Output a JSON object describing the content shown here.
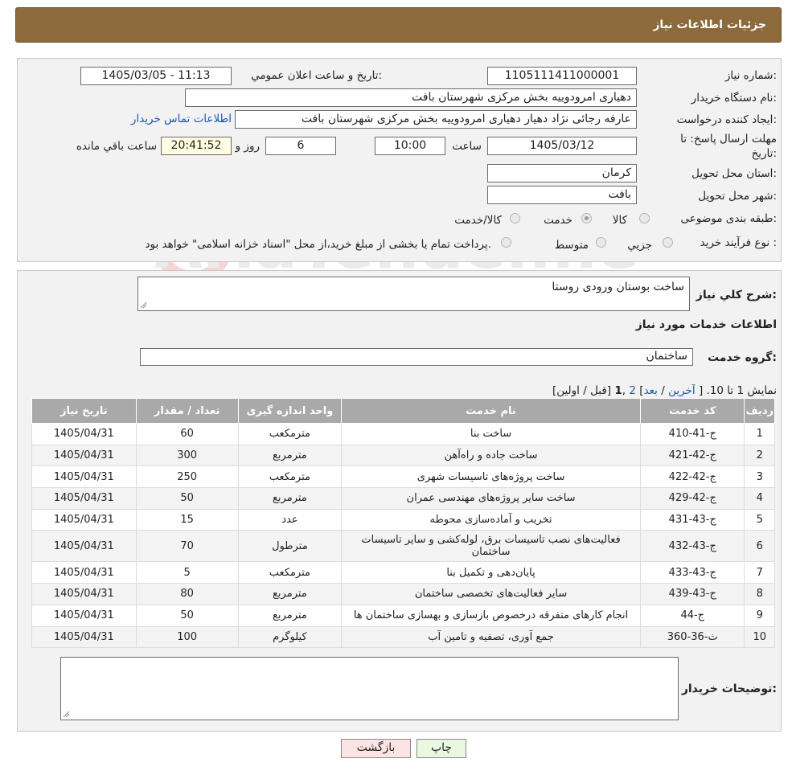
{
  "header": {
    "title": "جزئیات اطلاعات نیاز"
  },
  "form": {
    "need_number_label": "شماره نیاز:",
    "need_number": "1105111411000001",
    "announce_label": "تاریخ و ساعت اعلان عمومي:",
    "announce_value": "1405/03/05 - 11:13",
    "buyer_org_label": "نام دستگاه خريدار:",
    "buyer_org": "دهیاری امرودوییه بخش مرکزی شهرستان بافت",
    "creator_label": "ايجاد کننده درخواست:",
    "creator": "عارفه رجائی نژاد دهیار دهیاری امرودوییه بخش مرکزی شهرستان بافت",
    "contact_link": "اطلاعات تماس خريدار",
    "deadline_label_line1": "مهلت ارسال پاسخ: تا",
    "deadline_label_line2": "تاريخ:",
    "deadline_date": "1405/03/12",
    "time_label": "ساعت",
    "deadline_time": "10:00",
    "days_value": "6",
    "days_label": "روز و",
    "remaining_time": "20:41:52",
    "remaining_label": "ساعت باقي مانده",
    "province_label": "استان محل تحويل:",
    "province": "کرمان",
    "city_label": "شهر محل تحويل:",
    "city": "بافت",
    "category_label": "طبقه بندی موضوعی:",
    "category_options": [
      "کالا",
      "خدمت",
      "کالا/خدمت"
    ],
    "category_selected": "خدمت",
    "process_label": "نوع فرآيند خريد :",
    "process_options": [
      "جزيي",
      "متوسط"
    ],
    "process_note": "پرداخت تمام يا بخشی از مبلغ خريد،از محل \"اسناد خزانه اسلامی\" خواهد بود."
  },
  "details": {
    "summary_label": "شرح کلي نياز:",
    "summary_value": "ساخت بوستان ورودی روستا",
    "services_heading": "اطلاعات خدمات مورد نیاز",
    "service_group_label": "گروه خدمت:",
    "service_group_value": "ساختمان",
    "pagination": {
      "prefix": "نمایش 1 تا 10. [",
      "last": "آخرین",
      "sep1": "/",
      "next": "بعد",
      "sep2": "]",
      "page2": "2",
      "comma": ",",
      "page1": "1",
      "tail": "[قبل / اولین]"
    },
    "table": {
      "headers": [
        "رديف",
        "کد خدمت",
        "نام خدمت",
        "واحد اندازه گيری",
        "تعداد / مقدار",
        "تاريخ نياز"
      ],
      "rows": [
        [
          "1",
          "ج-41-410",
          "ساخت بنا",
          "مترمکعب",
          "60",
          "1405/04/31"
        ],
        [
          "2",
          "ج-42-421",
          "ساخت جاده و راه‌آهن",
          "مترمربع",
          "300",
          "1405/04/31"
        ],
        [
          "3",
          "ج-42-422",
          "ساخت پروژه‌های تاسیسات شهری",
          "مترمکعب",
          "250",
          "1405/04/31"
        ],
        [
          "4",
          "ج-42-429",
          "ساخت سایر پروژه‌های مهندسی عمران",
          "مترمربع",
          "50",
          "1405/04/31"
        ],
        [
          "5",
          "ج-43-431",
          "تخریب و آماده‌سازی محوطه",
          "عدد",
          "15",
          "1405/04/31"
        ],
        [
          "6",
          "ج-43-432",
          "فعالیت‌های نصب تاسیسات برق، لوله‌کشی و سایر تاسیسات ساختمان",
          "مترطول",
          "70",
          "1405/04/31"
        ],
        [
          "7",
          "ج-43-433",
          "پایان‌دهی و تکمیل بنا",
          "مترمکعب",
          "5",
          "1405/04/31"
        ],
        [
          "8",
          "ج-43-439",
          "سایر فعالیت‌های تخصصی ساختمان",
          "مترمربع",
          "80",
          "1405/04/31"
        ],
        [
          "9",
          "ج-44",
          "انجام کارهای متفرقه درخصوص بازسازی و بهسازی ساختمان ها",
          "مترمربع",
          "50",
          "1405/04/31"
        ],
        [
          "10",
          "ث-36-360",
          "جمع آوری، تصفیه و تامین آب",
          "کیلوگرم",
          "100",
          "1405/04/31"
        ]
      ]
    },
    "buyer_notes_label": "توضيحات خريدار:",
    "buyer_notes_value": ""
  },
  "buttons": {
    "print": "چاپ",
    "back": "بازگشت"
  },
  "watermark": {
    "text": "AriaTender.neT"
  },
  "colors": {
    "header": "#8c6a3c",
    "link": "#1a56b8",
    "table_header": "#a9a9a9",
    "back_button": "#fde4e4",
    "print_button": "#eaf8e2"
  }
}
